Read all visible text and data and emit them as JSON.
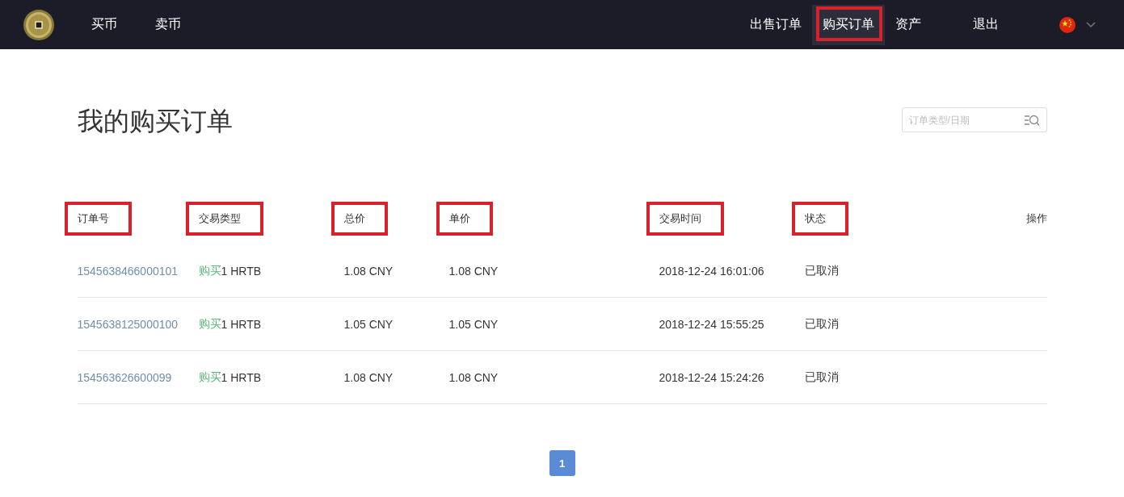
{
  "nav": {
    "left_items": [
      {
        "label": "买币",
        "selected": false,
        "highlighted": false
      },
      {
        "label": "卖币",
        "selected": false,
        "highlighted": false
      }
    ],
    "right_items": [
      {
        "label": "出售订单",
        "selected": false,
        "highlighted": false
      },
      {
        "label": "购买订单",
        "selected": true,
        "highlighted": true
      },
      {
        "label": "资产",
        "selected": false,
        "highlighted": false
      },
      {
        "label": "退出",
        "selected": false,
        "highlighted": false
      }
    ]
  },
  "page_title": "我的购买订单",
  "search": {
    "placeholder": "订单类型/日期"
  },
  "table": {
    "columns": [
      {
        "label": "订单号",
        "highlighted": true
      },
      {
        "label": "交易类型",
        "highlighted": true
      },
      {
        "label": "总价",
        "highlighted": true
      },
      {
        "label": "单价",
        "highlighted": true
      },
      {
        "label": "交易时间",
        "highlighted": true
      },
      {
        "label": "状态",
        "highlighted": true
      },
      {
        "label": "操作",
        "highlighted": false
      }
    ],
    "rows": [
      {
        "order_id": "1545638466000101",
        "trade_type": "购买",
        "quantity": "1 HRTB",
        "total": "1.08 CNY",
        "unit_price": "1.08 CNY",
        "time": "2018-12-24 16:01:06",
        "status": "已取消"
      },
      {
        "order_id": "1545638125000100",
        "trade_type": "购买",
        "quantity": "1 HRTB",
        "total": "1.05 CNY",
        "unit_price": "1.05 CNY",
        "time": "2018-12-24 15:55:25",
        "status": "已取消"
      },
      {
        "order_id": "154563626600099",
        "trade_type": "购买",
        "quantity": "1 HRTB",
        "total": "1.08 CNY",
        "unit_price": "1.08 CNY",
        "time": "2018-12-24 15:24:26",
        "status": "已取消"
      }
    ]
  },
  "pagination": [
    {
      "label": "1",
      "selected": true
    }
  ]
}
